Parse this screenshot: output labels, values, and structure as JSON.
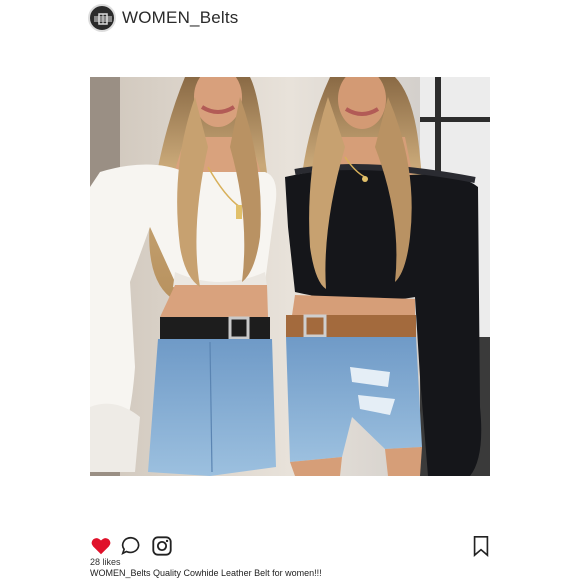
{
  "header": {
    "username": "WOMEN_Belts",
    "avatar_icon": "belt-avatar-icon"
  },
  "post": {
    "image_alt": "two women wearing belts",
    "likes_text": "28 likes",
    "caption": "WOMEN_Belts Quality Cowhide Leather Belt for women!!!"
  },
  "actions": {
    "like_icon": "heart-icon",
    "comment_icon": "comment-icon",
    "share_icon": "instagram-icon",
    "save_icon": "bookmark-icon"
  },
  "colors": {
    "heart": "#e0112a",
    "icon_stroke": "#222222"
  }
}
